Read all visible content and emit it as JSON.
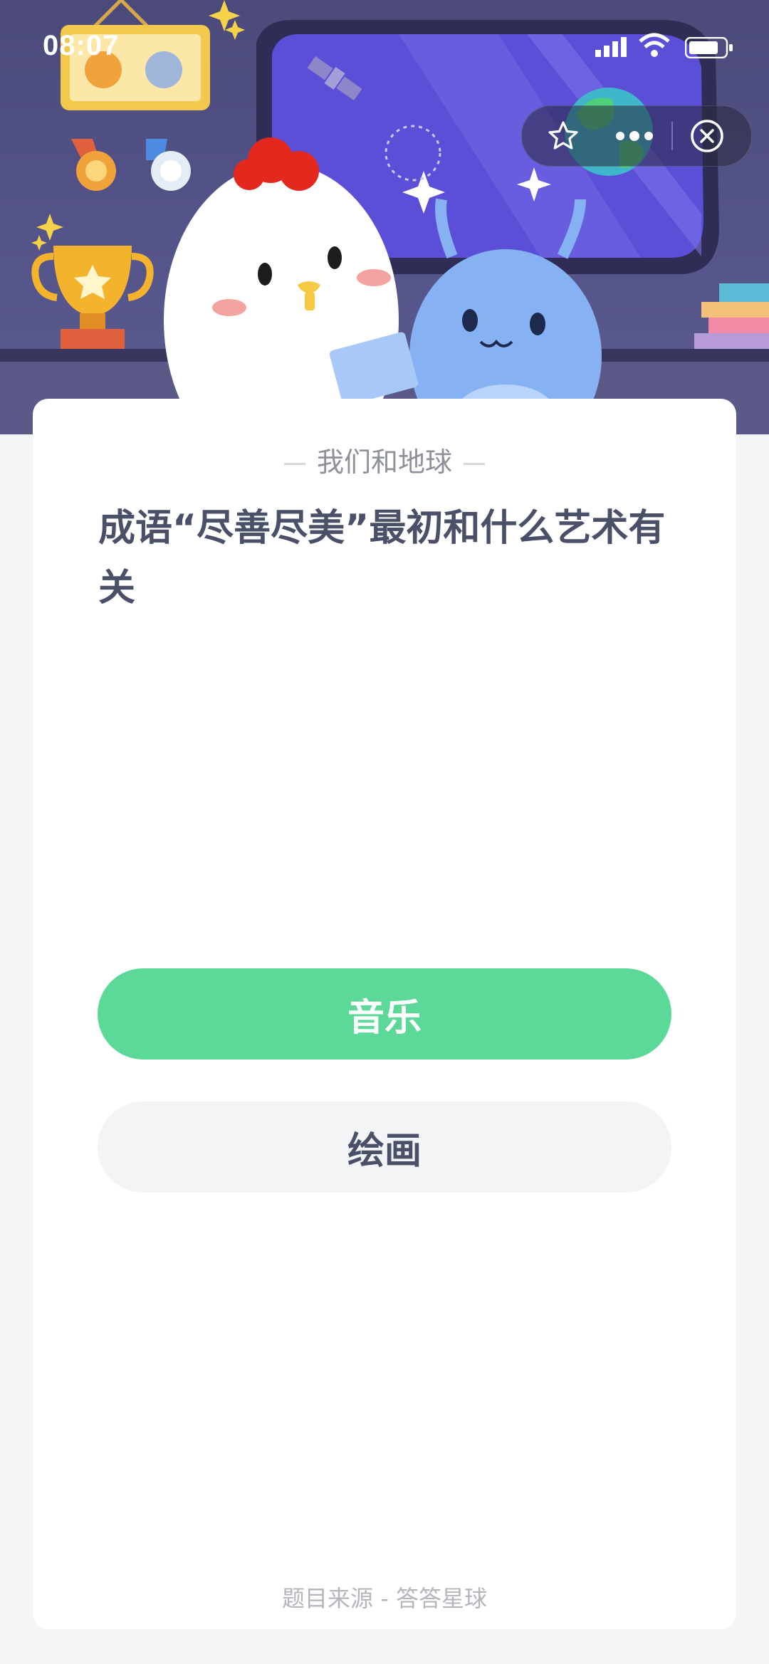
{
  "status_bar": {
    "time": "08:07"
  },
  "capsule": {
    "star_icon": "star-outline-icon",
    "more_icon": "more-dots-icon",
    "close_icon": "close-circle-icon"
  },
  "quiz": {
    "source_title": "我们和地球",
    "question": "成语“尽善尽美”最初和什么艺术有关",
    "options": [
      {
        "label": "音乐",
        "state": "correct",
        "color": "#5cd898"
      },
      {
        "label": "绘画",
        "state": "normal",
        "color": "#f3f4f6"
      }
    ],
    "footer": "题目来源 - 答答星球"
  }
}
